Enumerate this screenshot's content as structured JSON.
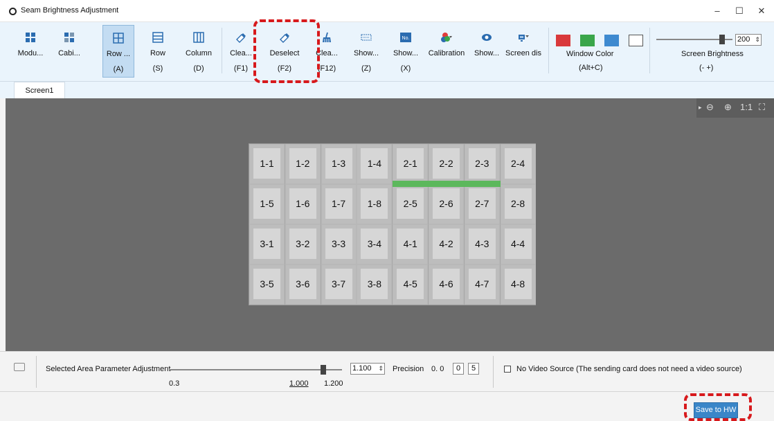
{
  "window": {
    "title": "Seam Brightness Adjustment",
    "minimize": "–",
    "maximize": "☐",
    "close": "✕"
  },
  "toolbar": {
    "buttons": [
      {
        "label": "Modu...",
        "key": ""
      },
      {
        "label": "Cabi...",
        "key": ""
      },
      {
        "label": "Row ...",
        "key": "(A)"
      },
      {
        "label": "Row",
        "key": "(S)"
      },
      {
        "label": "Column",
        "key": "(D)"
      },
      {
        "label": "Clea...",
        "key": "(F1)"
      },
      {
        "label": "Deselect",
        "key": "(F2)"
      },
      {
        "label": "Clea...",
        "key": "(F12)"
      },
      {
        "label": "Show...",
        "key": "(Z)"
      },
      {
        "label": "Show...",
        "key": "(X)"
      },
      {
        "label": "Calibration",
        "key": ""
      },
      {
        "label": "Show...",
        "key": ""
      },
      {
        "label": "Screen dis",
        "key": ""
      }
    ],
    "window_color": {
      "label": "Window Color",
      "key": "(Alt+C)",
      "swatches": [
        "#d9393b",
        "#3aa64a",
        "#3e8ad0",
        "#ffffff"
      ]
    },
    "screen_brightness": {
      "label": "Screen Brightness",
      "key": "(-  +)",
      "value": "200",
      "level": 0.86
    }
  },
  "tabs": [
    {
      "label": "Screen1"
    }
  ],
  "canvas": {
    "tools": {
      "expand": "▸",
      "zoom_out": "⊖",
      "zoom_in": "⊕",
      "actual": "1:1",
      "fit": "⛶"
    },
    "cells": [
      [
        "1-1",
        "1-2",
        "1-3",
        "1-4",
        "2-1",
        "2-2",
        "2-3",
        "2-4"
      ],
      [
        "1-5",
        "1-6",
        "1-7",
        "1-8",
        "2-5",
        "2-6",
        "2-7",
        "2-8"
      ],
      [
        "3-1",
        "3-2",
        "3-3",
        "3-4",
        "4-1",
        "4-2",
        "4-3",
        "4-4"
      ],
      [
        "3-5",
        "3-6",
        "3-7",
        "3-8",
        "4-5",
        "4-6",
        "4-7",
        "4-8"
      ]
    ],
    "seam_color": "#5cb85c"
  },
  "bottom": {
    "param_label": "Selected Area Parameter Adjustment",
    "min": "0.3",
    "mid": "1.000",
    "max": "1.200",
    "value": "1.100",
    "level": 0.89,
    "precision_label": "Precision",
    "precision_prefix": "0.  0",
    "precision_a": "0",
    "precision_b": "5",
    "no_video_label": "No Video Source  (The sending card does not need a video source)"
  },
  "footer": {
    "save_label": "Save to HW"
  },
  "highlight_color": "#d7191c"
}
